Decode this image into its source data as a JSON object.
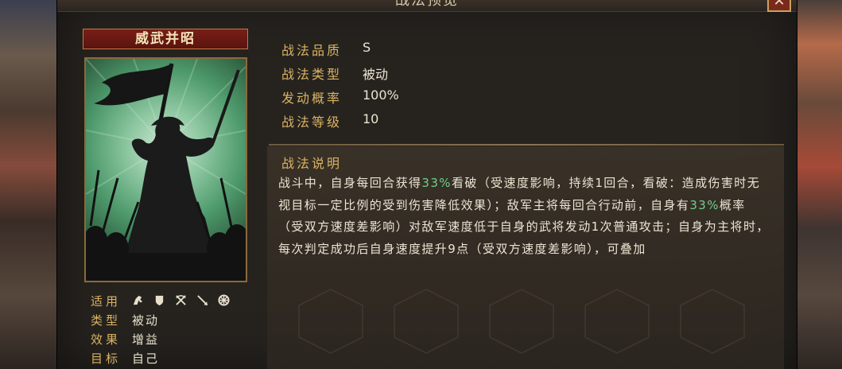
{
  "window": {
    "title": "战法预览",
    "close_label": "✕"
  },
  "card": {
    "name": "威武并昭",
    "attributes": [
      {
        "key": "适用",
        "icons": [
          "cavalry-icon",
          "shield-icon",
          "bow-icon",
          "spear-icon",
          "siege-icon"
        ]
      },
      {
        "key": "类型",
        "value": "被动"
      },
      {
        "key": "效果",
        "value": "增益"
      },
      {
        "key": "目标",
        "value": "自己"
      }
    ]
  },
  "info": [
    {
      "key": "战法品质",
      "value": "S"
    },
    {
      "key": "战法类型",
      "value": "被动"
    },
    {
      "key": "发动概率",
      "value": "100%"
    },
    {
      "key": "战法等级",
      "value": "10"
    }
  ],
  "description": {
    "title": "战法说明",
    "segments": [
      {
        "text": "战斗中，自身每回合获得",
        "hl": false
      },
      {
        "text": "33%",
        "hl": true
      },
      {
        "text": "看破（受速度影响，持续1回合，看破：造成伤害时无视目标一定比例的受到伤害降低效果）；敌军主将每回合行动前，自身有",
        "hl": false
      },
      {
        "text": "33%",
        "hl": true
      },
      {
        "text": "概率（受双方速度差影响）对敌军速度低于自身的武将发动1次普通攻击；自身为主将时，每次判定成功后自身速度提升9点（受双方速度差影响），可叠加",
        "hl": false
      }
    ]
  },
  "colors": {
    "gold_label": "#d9b364",
    "highlight_green": "#6fd08a",
    "title_red": "#7a1e16"
  }
}
